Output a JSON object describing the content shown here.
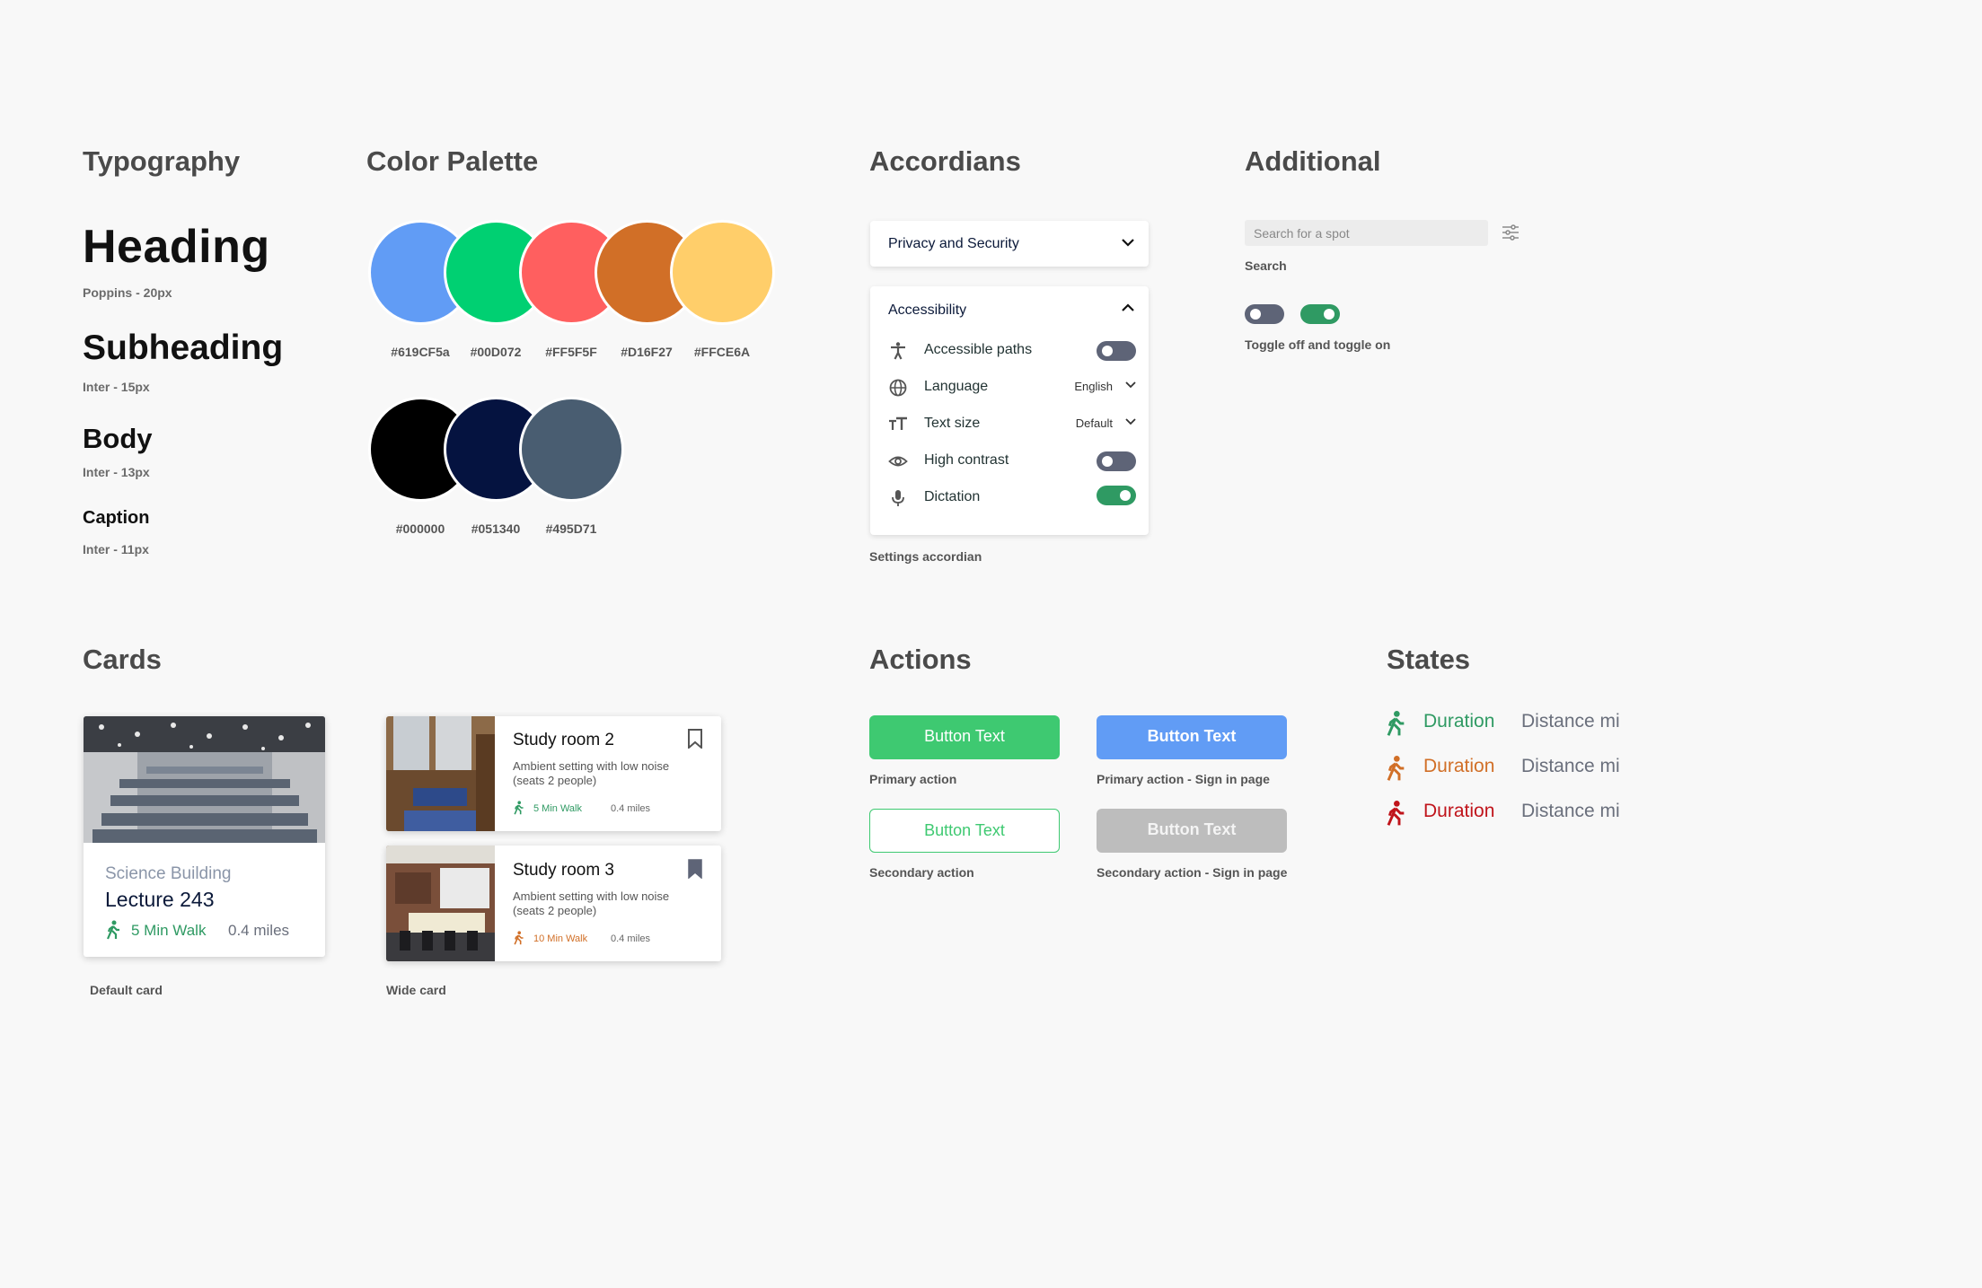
{
  "sections": {
    "typography": "Typography",
    "palette": "Color Palette",
    "accordions": "Accordians",
    "additional": "Additional",
    "cards": "Cards",
    "actions": "Actions",
    "states": "States"
  },
  "typography": {
    "heading": "Heading",
    "heading_meta": "Poppins - 20px",
    "subheading": "Subheading",
    "subheading_meta": "Inter - 15px",
    "body": "Body",
    "body_meta": "Inter - 13px",
    "caption": "Caption",
    "caption_meta": "Inter - 11px"
  },
  "palette": {
    "row1": [
      {
        "hex": "#619CF5a",
        "color": "#619CF5"
      },
      {
        "hex": "#00D072",
        "color": "#00D072"
      },
      {
        "hex": "#FF5F5F",
        "color": "#FF5F5F"
      },
      {
        "hex": "#D16F27",
        "color": "#D16F27"
      },
      {
        "hex": "#FFCE6A",
        "color": "#FFCE6A"
      }
    ],
    "row2": [
      {
        "hex": "#000000",
        "color": "#000000"
      },
      {
        "hex": "#051340",
        "color": "#051340"
      },
      {
        "hex": "#495D71",
        "color": "#495D71"
      }
    ]
  },
  "accordion": {
    "collapsed_title": "Privacy and Security",
    "expanded_title": "Accessibility",
    "rows": [
      {
        "label": "Accessible paths",
        "icon": "accessibility-icon",
        "toggle": "off"
      },
      {
        "label": "Language",
        "icon": "globe-icon",
        "value": "English"
      },
      {
        "label": "Text size",
        "icon": "text-size-icon",
        "value": "Default"
      },
      {
        "label": "High contrast",
        "icon": "eye-icon",
        "toggle": "off"
      },
      {
        "label": "Dictation",
        "icon": "microphone-icon",
        "toggle": "on"
      }
    ],
    "caption": "Settings accordian"
  },
  "additional": {
    "search_placeholder": "Search for a spot",
    "search_caption": "Search",
    "toggle_caption": "Toggle off and toggle on"
  },
  "cards": {
    "default": {
      "building": "Science Building",
      "room": "Lecture 243",
      "walk": "5 Min Walk",
      "distance": "0.4 miles",
      "caption": "Default card"
    },
    "wide": [
      {
        "title": "Study room 2",
        "desc": "Ambient setting with low noise (seats 2 people)",
        "walk": "5 Min Walk",
        "distance": "0.4 miles",
        "bookmarked": false,
        "walk_color": "#2f9a63"
      },
      {
        "title": "Study room 3",
        "desc": "Ambient setting with low noise (seats 2 people)",
        "walk": "10 Min Walk",
        "distance": "0.4 miles",
        "bookmarked": true,
        "walk_color": "#d16f27"
      }
    ],
    "wide_caption": "Wide card"
  },
  "actions": {
    "primary_label": "Button Text",
    "primary_caption": "Primary action",
    "primary_sign_label": "Button Text",
    "primary_sign_caption": "Primary action - Sign in page",
    "secondary_label": "Button Text",
    "secondary_caption": "Secondary action",
    "secondary_sign_label": "Button Text",
    "secondary_sign_caption": "Secondary action - Sign in page"
  },
  "states": [
    {
      "duration": "Duration",
      "distance": "Distance mi",
      "color": "#2f9a63"
    },
    {
      "duration": "Duration",
      "distance": "Distance mi",
      "color": "#d16f27"
    },
    {
      "duration": "Duration",
      "distance": "Distance mi",
      "color": "#c0141b"
    }
  ]
}
